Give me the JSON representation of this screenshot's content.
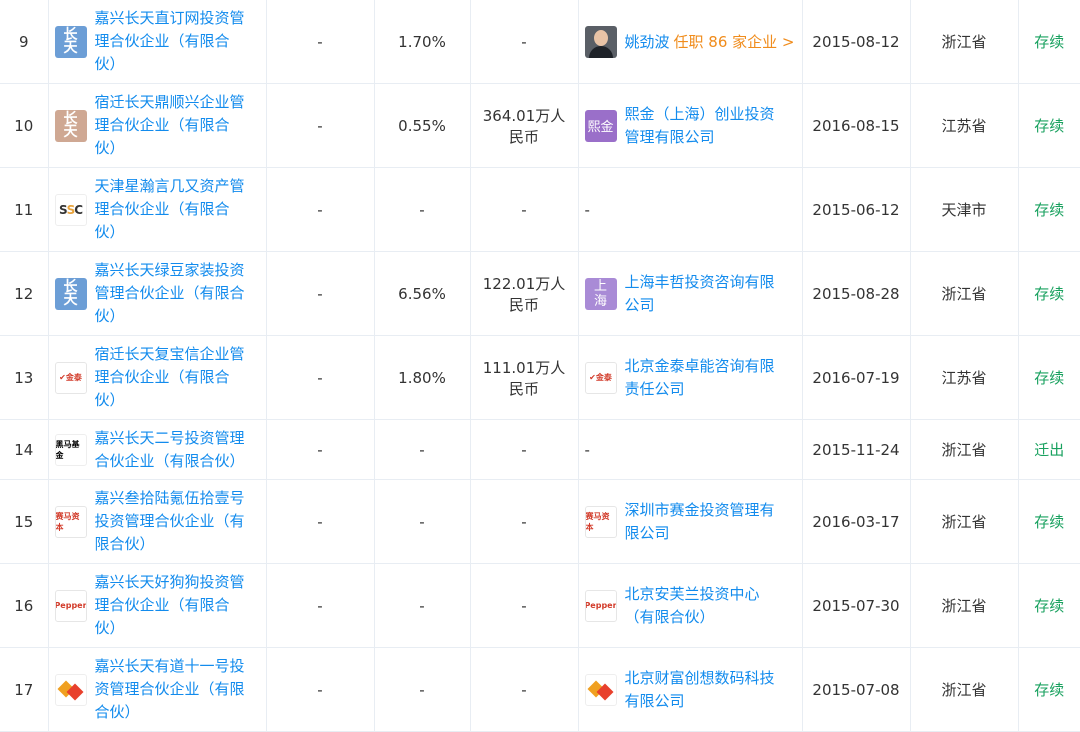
{
  "rows": [
    {
      "idx": "9",
      "company": "嘉兴长天直订网投资管理合伙企业（有限合伙）",
      "company_lines": [
        "嘉兴长天直订网投资管",
        "理合伙企业（有限合",
        "伙）"
      ],
      "logo": "长天",
      "logo_icon": "changtian-logo-icon",
      "col_a": "-",
      "ratio": "1.70%",
      "capital": "-",
      "holder": "姚劲波",
      "holder_tag": "任职 86 家企业 >",
      "holder_icon": "person-avatar-icon",
      "date": "2015-08-12",
      "province": "浙江省",
      "status": "存续"
    },
    {
      "idx": "10",
      "company": "宿迁长天鼎顺兴企业管理合伙企业（有限合伙）",
      "company_lines": [
        "宿迁长天鼎顺兴企业管",
        "理合伙企业（有限合",
        "伙）"
      ],
      "logo": "长天",
      "logo_icon": "changtian-logo-icon",
      "col_a": "-",
      "ratio": "0.55%",
      "capital_lines": [
        "364.01万人",
        "民币"
      ],
      "holder_lines": [
        "熙金（上海）创业投资",
        "管理有限公司"
      ],
      "holder_logo": "熙金",
      "holder_icon": "xijin-logo-icon",
      "date": "2016-08-15",
      "province": "江苏省",
      "status": "存续"
    },
    {
      "idx": "11",
      "company": "天津星瀚言几又资产管理合伙企业（有限合伙）",
      "company_lines": [
        "天津星瀚言几又资产管",
        "理合伙企业（有限合",
        "伙）"
      ],
      "logo": "SSC",
      "logo_icon": "ssc-logo-icon",
      "col_a": "-",
      "ratio": "-",
      "capital": "-",
      "holder": "-",
      "date": "2015-06-12",
      "province": "天津市",
      "status": "存续"
    },
    {
      "idx": "12",
      "company": "嘉兴长天绿豆家装投资管理合伙企业（有限合伙）",
      "company_lines": [
        "嘉兴长天绿豆家装投资",
        "管理合伙企业（有限合",
        "伙）"
      ],
      "logo": "长天",
      "logo_icon": "changtian-logo-icon",
      "col_a": "-",
      "ratio": "6.56%",
      "capital_lines": [
        "122.01万人",
        "民币"
      ],
      "holder_lines": [
        "上海丰哲投资咨询有限",
        "公司"
      ],
      "holder_logo": "上海",
      "holder_icon": "shanghai-logo-icon",
      "date": "2015-08-28",
      "province": "浙江省",
      "status": "存续"
    },
    {
      "idx": "13",
      "company": "宿迁长天复宝信企业管理合伙企业（有限合伙）",
      "company_lines": [
        "宿迁长天复宝信企业管",
        "理合伙企业（有限合",
        "伙）"
      ],
      "logo": "金泰",
      "logo_icon": "jintai-logo-icon",
      "col_a": "-",
      "ratio": "1.80%",
      "capital_lines": [
        "111.01万人",
        "民币"
      ],
      "holder_lines": [
        "北京金泰卓能咨询有限",
        "责任公司"
      ],
      "holder_logo": "金泰",
      "holder_icon": "jintai-logo-icon",
      "date": "2016-07-19",
      "province": "江苏省",
      "status": "存续"
    },
    {
      "idx": "14",
      "company": "嘉兴长天二号投资管理合伙企业（有限合伙）",
      "company_lines": [
        "嘉兴长天二号投资管理",
        "合伙企业（有限合伙）"
      ],
      "logo": "黑马",
      "logo_icon": "heima-logo-icon",
      "col_a": "-",
      "ratio": "-",
      "capital": "-",
      "holder": "-",
      "date": "2015-11-24",
      "province": "浙江省",
      "status": "迁出"
    },
    {
      "idx": "15",
      "company": "嘉兴叁拾陆氪伍拾壹号投资管理合伙企业（有限合伙）",
      "company_lines": [
        "嘉兴叁拾陆氪伍拾壹号",
        "投资管理合伙企业（有",
        "限合伙）"
      ],
      "logo": "赛马",
      "logo_icon": "saima-logo-icon",
      "col_a": "-",
      "ratio": "-",
      "capital": "-",
      "holder_lines": [
        "深圳市赛金投资管理有",
        "限公司"
      ],
      "holder_logo": "赛马",
      "holder_icon": "saima-logo-icon",
      "date": "2016-03-17",
      "province": "浙江省",
      "status": "存续"
    },
    {
      "idx": "16",
      "company": "嘉兴长天好狗狗投资管理合伙企业（有限合伙）",
      "company_lines": [
        "嘉兴长天好狗狗投资管",
        "理合伙企业（有限合",
        "伙）"
      ],
      "logo": "Pepper",
      "logo_icon": "pepper-logo-icon",
      "col_a": "-",
      "ratio": "-",
      "capital": "-",
      "holder_lines": [
        "北京安芙兰投资中心",
        "（有限合伙）"
      ],
      "holder_logo": "Pepper",
      "holder_icon": "pepper-logo-icon",
      "date": "2015-07-30",
      "province": "浙江省",
      "status": "存续"
    },
    {
      "idx": "17",
      "company": "嘉兴长天有道十一号投资管理合伙企业（有限合伙）",
      "company_lines": [
        "嘉兴长天有道十一号投",
        "资管理合伙企业（有限",
        "合伙）"
      ],
      "logo": "",
      "logo_icon": "caifu-logo-icon",
      "col_a": "-",
      "ratio": "-",
      "capital": "-",
      "holder_lines": [
        "北京财富创想数码科技",
        "有限公司"
      ],
      "holder_logo": "",
      "holder_icon": "caifu-logo-icon",
      "date": "2015-07-08",
      "province": "浙江省",
      "status": "存续"
    }
  ],
  "colors": {
    "link": "#128bed",
    "status_active": "#19a15f",
    "tag_orange": "#f08c1c",
    "border": "#e8edf3"
  }
}
